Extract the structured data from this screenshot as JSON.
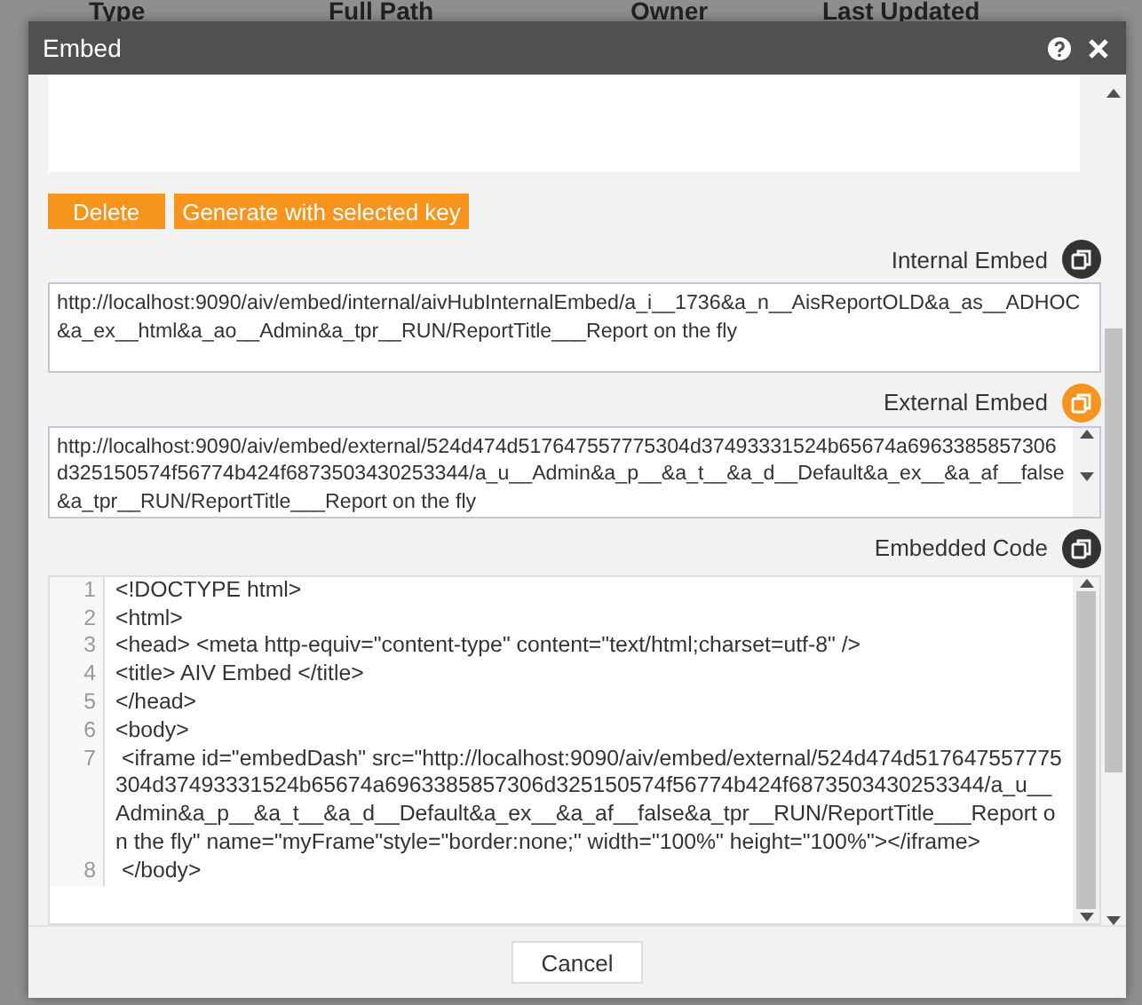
{
  "background_table": {
    "columns": [
      "Type",
      "Full Path",
      "Owner",
      "Last Updated"
    ]
  },
  "dialog": {
    "title": "Embed",
    "buttons": [
      {
        "label": "Delete"
      },
      {
        "label": "Generate with selected key"
      }
    ],
    "internal_embed": {
      "label": "Internal Embed",
      "value": "http://localhost:9090/aiv/embed/internal/aivHubInternalEmbed/a_i__1736&a_n__AisReportOLD&a_as__ADHOC&a_ex__html&a_ao__Admin&a_tpr__RUN/ReportTitle___Report on the fly",
      "highlighted": false
    },
    "external_embed": {
      "label": "External Embed",
      "value": "http://localhost:9090/aiv/embed/external/524d474d517647557775304d37493331524b65674a6963385857306d325150574f56774b424f6873503430253344/a_u__Admin&a_p__&a_t__&a_d__Default&a_ex__&a_af__false&a_tpr__RUN/ReportTitle___Report on the fly",
      "highlighted": true
    },
    "embedded_code": {
      "label": "Embedded Code",
      "highlighted": false,
      "lines": [
        {
          "number": "1",
          "text": "<!DOCTYPE html>"
        },
        {
          "number": "2",
          "text": "<html>"
        },
        {
          "number": "3",
          "text": "<head> <meta http-equiv=\"content-type\" content=\"text/html;charset=utf-8\" />"
        },
        {
          "number": "4",
          "text": "<title> AIV Embed </title>"
        },
        {
          "number": "5",
          "text": "</head>"
        },
        {
          "number": "6",
          "text": "<body>"
        },
        {
          "number": "7",
          "text": " <iframe id=\"embedDash\" src=\"http://localhost:9090/aiv/embed/external/524d474d517647557775304d37493331524b65674a6963385857306d325150574f56774b424f6873503430253344/a_u__Admin&a_p__&a_t__&a_d__Default&a_ex__&a_af__false&a_tpr__RUN/ReportTitle___Report on the fly\" name=\"myFrame\"style=\"border:none;\" width=\"100%\" height=\"100%\"></iframe>"
        },
        {
          "number": "8",
          "text": " </body>"
        }
      ]
    },
    "cancel": "Cancel"
  }
}
